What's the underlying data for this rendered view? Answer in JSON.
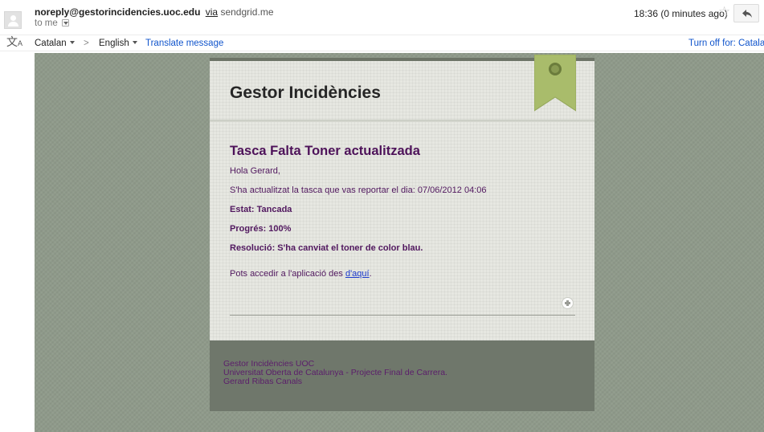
{
  "header": {
    "sender_email": "noreply@gestorincidencies.uoc.edu",
    "via_label": "via",
    "via_host": "sendgrid.me",
    "to_label": "to me",
    "timestamp": "18:36 (0 minutes ago)",
    "star_icon": "star-icon",
    "reply_icon": "reply-icon"
  },
  "translate_bar": {
    "source_language": "Catalan",
    "arrow": ">",
    "target_language": "English",
    "translate_link": "Translate message",
    "turn_off_link": "Turn off for: Catalan"
  },
  "email": {
    "brand_title": "Gestor Incidències",
    "subject": "Tasca Falta Toner actualitzada",
    "greeting": "Hola Gerard,",
    "intro": "S'ha actualitzat la tasca que vas reportar el dia: 07/06/2012 04:06",
    "status": "Estat: Tancada",
    "progress": "Progrés: 100%",
    "resolution": "Resolució: S'ha canviat el toner de color blau.",
    "access_text": "Pots accedir a l'aplicació des ",
    "access_link": "d'aquí",
    "access_suffix": ".",
    "footer": {
      "line1": "Gestor Incidències UOC",
      "line2": "Universitat Oberta de Catalunya - Projecte Final de Carrera.",
      "line3": "Gerard Ribas Canals"
    }
  },
  "colors": {
    "link": "#1155cc",
    "email_text": "#51185f",
    "email_bg": "#8f9a8a",
    "card_bg": "#e6e7e1",
    "footer_bg": "#6f776b",
    "ribbon": "#a9bc6b"
  }
}
